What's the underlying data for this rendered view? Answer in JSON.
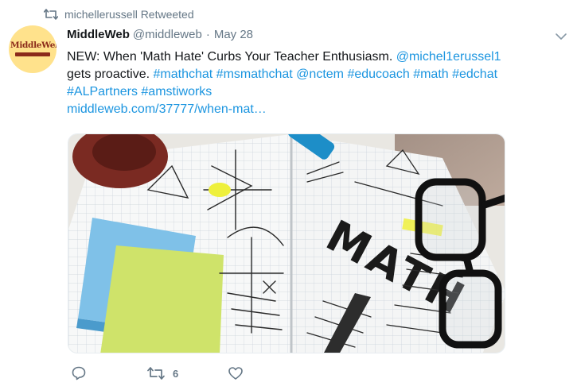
{
  "retweet_context": {
    "icon": "retweet-icon",
    "text": "michellerussell Retweeted"
  },
  "author": {
    "avatar_text": "MiddleWeb",
    "name": "MiddleWeb",
    "handle": "@middleweb",
    "separator": "·",
    "date": "May 28"
  },
  "tweet": {
    "text_intro": "NEW: When 'Math Hate' Curbs Your Teacher Enthusiasm. ",
    "mention_1": "@michel1erussel1",
    "text_mid": " gets proactive. ",
    "hashtags": [
      "#mathchat",
      "#msmathchat",
      "@nctem",
      "#educoach",
      "#math",
      "#edchat",
      "#ALPartners",
      "#amstiworks"
    ],
    "url": "middleweb.com/37777/when-mat…",
    "link_color": "#1b95e0"
  },
  "media": {
    "image_word": "MATH",
    "description_icon": "math-notebook-photo"
  },
  "actions": {
    "reply_icon": "reply-icon",
    "retweet_icon": "retweet-icon",
    "retweet_count": "6",
    "like_icon": "heart-icon",
    "menu_icon": "chevron-down-icon"
  }
}
